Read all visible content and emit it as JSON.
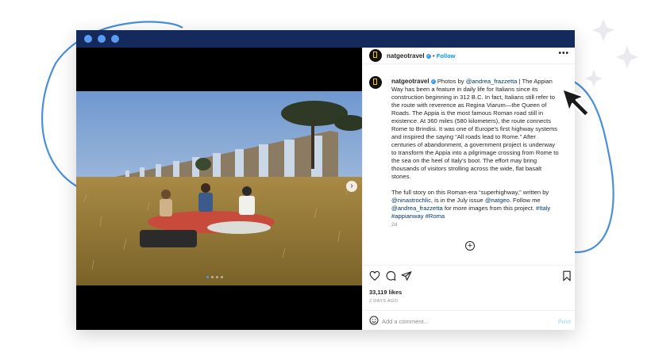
{
  "post": {
    "username": "natgeotravel",
    "verified_mark": "✓",
    "separator": "•",
    "follow_label": "Follow",
    "more_label": "•••",
    "caption_parts": {
      "p1_a": " Photos by ",
      "mention_photographer": "@andrea_frazzetta",
      "p1_b": " | The Appian Way has been a feature in daily life for Italians since its construction beginning in 312 B.C. In fact, Italians still refer to the route with reverence as Regina Viarum—the Queen of Roads. The Appia is the most famous Roman road still in existence. At 360 miles (580 kilometers), the route connects Rome to Brindisi. It was one of Europe's first highway systems and inspired the saying “All roads lead to Rome.” After centuries of abandonment, a government project is underway to transform the Appia into a pilgrimage crossing from Rome to the sea on the heel of Italy's boot. The effort may bring thousands of visitors strolling across the wide, flat basalt stones.",
      "p2_a": "The full story on this Roman-era “superhighway,” written by ",
      "mention_writer": "@ninastrochlic",
      "p2_b": ", is in the July issue ",
      "mention_natgeo": "@natgeo",
      "p2_c": ". Follow me ",
      "mention_photographer2": "@andrea_frazzetta",
      "p2_d": " for more images from this project. ",
      "tag1": "#Italy",
      "tag2": "#appianway",
      "tag3": "#Roma"
    },
    "age": "2d",
    "likes": "33,119 likes",
    "posted": "2 DAYS AGO",
    "comment_placeholder": "Add a comment...",
    "post_label": "Post",
    "next_arrow": "›",
    "add_symbol": "+"
  },
  "carousel": {
    "count": 4,
    "active": 1
  },
  "colors": {
    "titlebar": "#14295c",
    "window_dots": "#5b9cf0",
    "deco_line": "#4a90d9",
    "link": "#00376b",
    "follow": "#0095f6",
    "logo_yellow": "#f7c600"
  },
  "icons": [
    "heart-icon",
    "comment-icon",
    "share-icon",
    "bookmark-icon",
    "emoji-icon",
    "more-icon",
    "plus-circle-icon",
    "cursor-arrow-icon",
    "sparkle-star-icon"
  ]
}
